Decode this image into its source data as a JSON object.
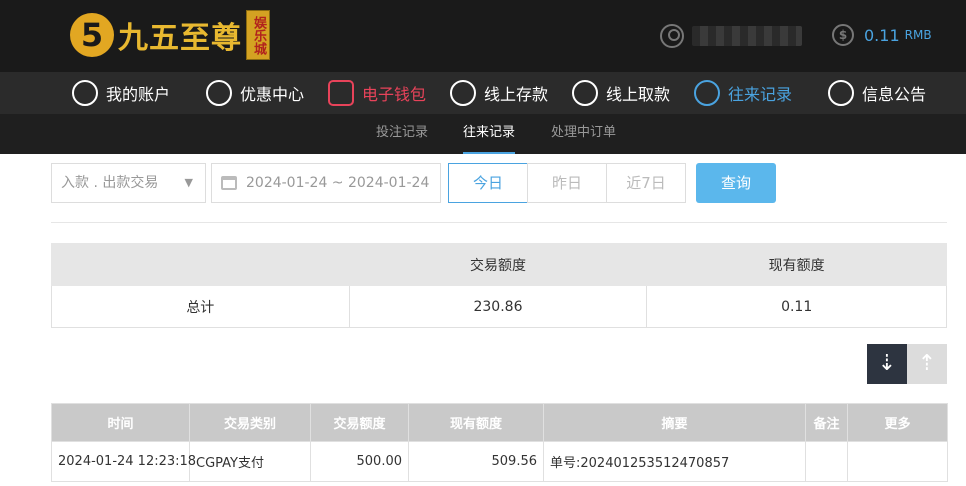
{
  "header": {
    "brand_name": "九五至尊",
    "brand_badge": "娱乐城",
    "username_masked": "",
    "balance_value": "0.11",
    "balance_unit": "RMB"
  },
  "main_nav": [
    {
      "label": "我的账户",
      "icon": "user-icon"
    },
    {
      "label": "优惠中心",
      "icon": "gift-icon"
    },
    {
      "label": "电子钱包",
      "icon": "wallet-icon"
    },
    {
      "label": "线上存款",
      "icon": "deposit-icon"
    },
    {
      "label": "线上取款",
      "icon": "withdraw-icon"
    },
    {
      "label": "往来记录",
      "icon": "records-icon"
    },
    {
      "label": "信息公告",
      "icon": "bell-icon"
    }
  ],
  "sub_nav": [
    {
      "label": "投注记录"
    },
    {
      "label": "往来记录"
    },
    {
      "label": "处理中订单"
    }
  ],
  "filter": {
    "type_select": "入款 . 出款交易",
    "date_range": "2024-01-24 ~ 2024-01-24",
    "quick_today": "今日",
    "quick_yesterday": "昨日",
    "quick_7days": "近7日",
    "query_label": "查询"
  },
  "summary": {
    "headers": [
      "",
      "交易额度",
      "现有额度"
    ],
    "row": [
      "总计",
      "230.86",
      "0.11"
    ]
  },
  "records": {
    "headers": [
      "时间",
      "交易类别",
      "交易额度",
      "现有额度",
      "摘要",
      "备注",
      "更多"
    ],
    "rows": [
      [
        "2024-01-24 12:23:18",
        "CGPAY支付",
        "500.00",
        "509.56",
        "单号:202401253512470857",
        "",
        ""
      ]
    ]
  },
  "colors": {
    "accent": "#4aa3e0",
    "wallet": "#e8435a",
    "brand_gold": "#e2a722"
  }
}
